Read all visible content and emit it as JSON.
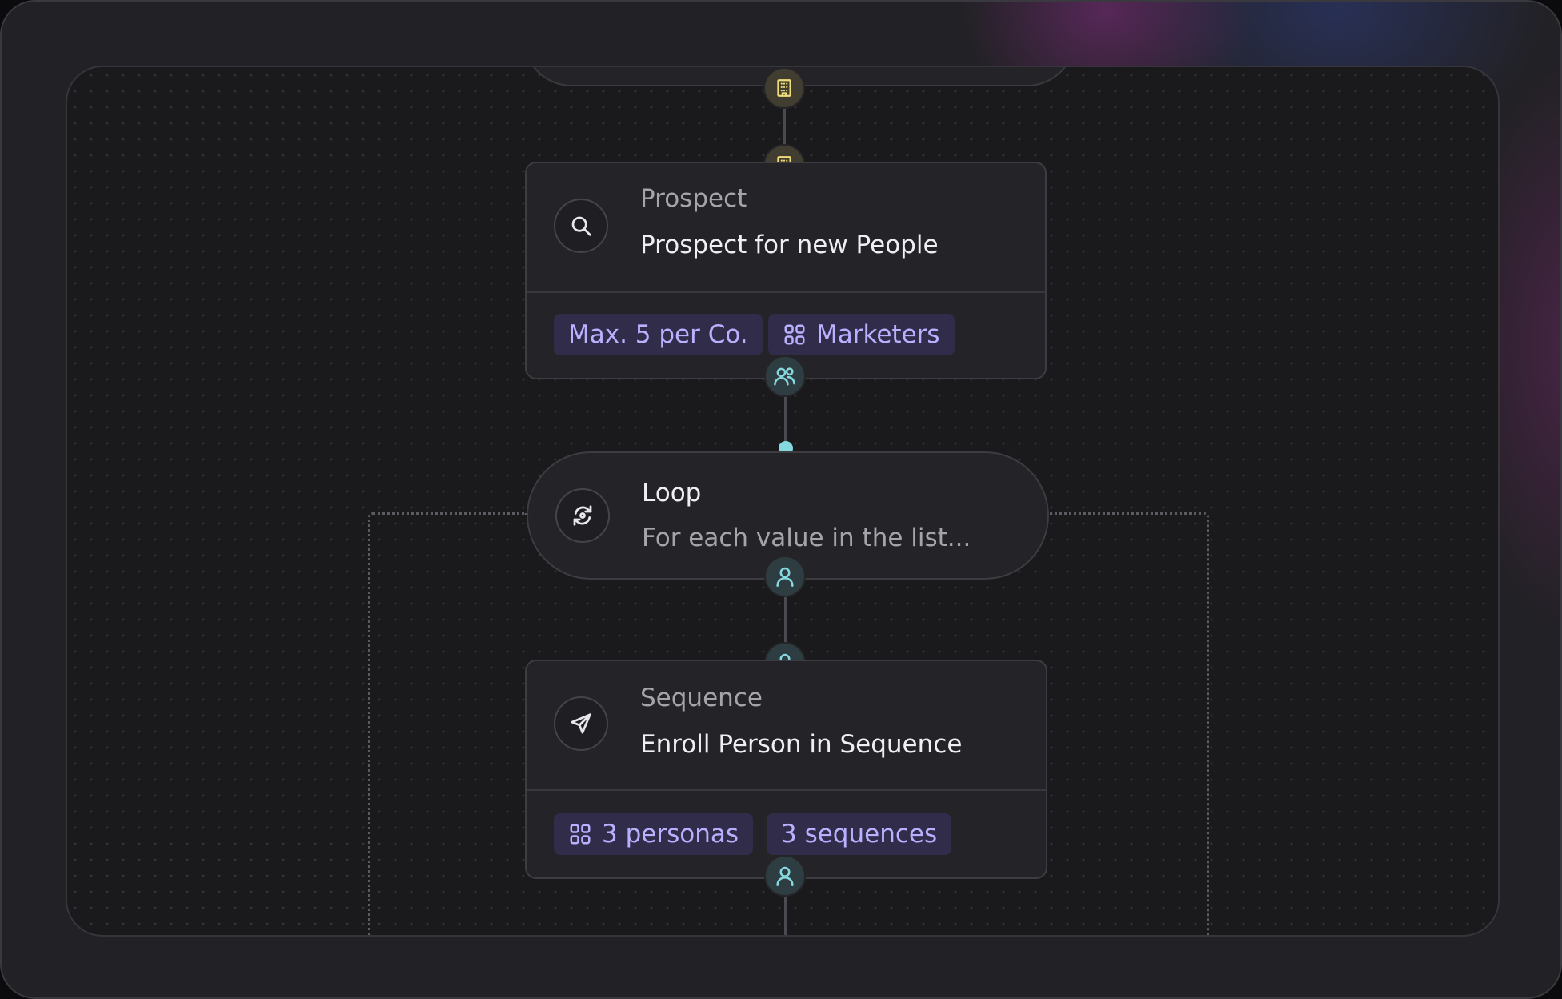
{
  "prospect": {
    "category": "Prospect",
    "title": "Prospect for new People",
    "chips": [
      "Max. 5 per Co.",
      "Marketers"
    ]
  },
  "loop": {
    "title": "Loop",
    "subtitle": "For each value in the list..."
  },
  "sequence": {
    "category": "Sequence",
    "title": "Enroll Person in Sequence",
    "chips": [
      "3 personas",
      "3 sequences"
    ]
  },
  "colors": {
    "background": "#222125",
    "canvas": "#1a191c",
    "card": "#242327",
    "chip_bg": "#302c4a",
    "chip_text": "#b9b1ff",
    "accent_teal": "#85d8de",
    "accent_yellow": "#f1dc7a"
  },
  "icons": {
    "prospect": "search-icon",
    "loop": "refresh-loop-icon",
    "sequence": "send-icon",
    "company_port": "building-icon",
    "people_port": "users-icon",
    "person_port": "user-icon",
    "chip": "grid-icon"
  }
}
